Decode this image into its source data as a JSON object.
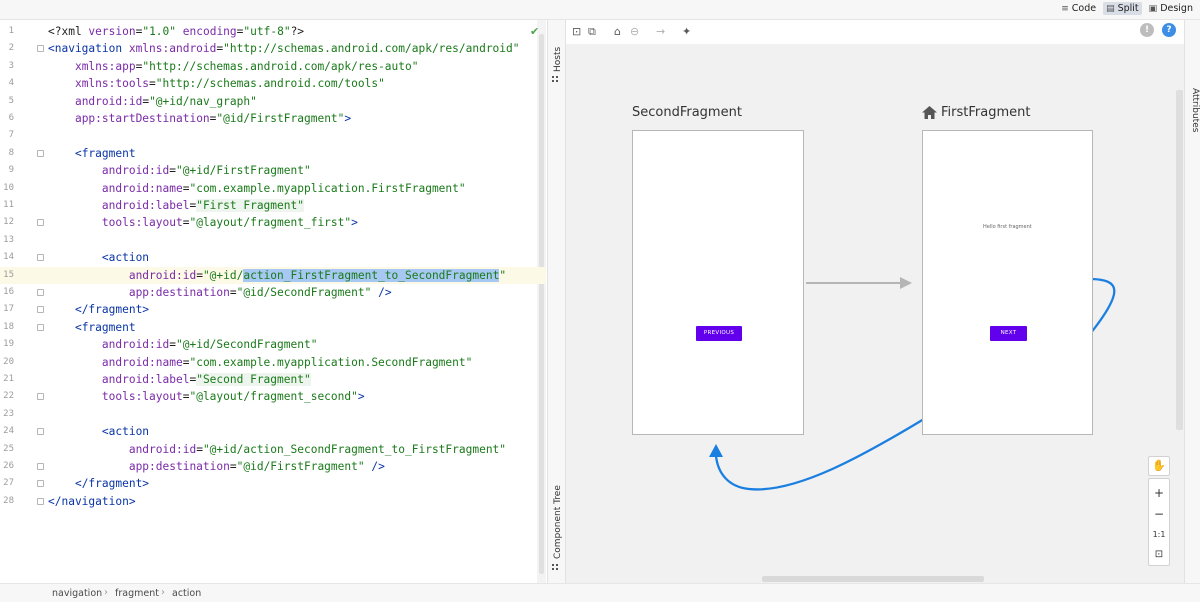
{
  "modes": {
    "code": "Code",
    "split": "Split",
    "design": "Design",
    "active": "split"
  },
  "editor": {
    "lines": [
      {
        "n": "1",
        "parts": [
          [
            "pun",
            "<?xml "
          ],
          [
            "attr",
            "version"
          ],
          [
            "pun",
            "="
          ],
          [
            "val",
            "\"1.0\""
          ],
          [
            "pun",
            " "
          ],
          [
            "attr",
            "encoding"
          ],
          [
            "pun",
            "="
          ],
          [
            "val",
            "\"utf-8\""
          ],
          [
            "pun",
            "?>"
          ]
        ]
      },
      {
        "n": "2",
        "parts": [
          [
            "tag",
            "<navigation "
          ],
          [
            "attr",
            "xmlns:android"
          ],
          [
            "pun",
            "="
          ],
          [
            "val",
            "\"http://schemas.android.com/apk/res/android\""
          ]
        ]
      },
      {
        "n": "3",
        "parts": [
          [
            "pun",
            "    "
          ],
          [
            "attr",
            "xmlns:app"
          ],
          [
            "pun",
            "="
          ],
          [
            "val",
            "\"http://schemas.android.com/apk/res-auto\""
          ]
        ]
      },
      {
        "n": "4",
        "parts": [
          [
            "pun",
            "    "
          ],
          [
            "attr",
            "xmlns:tools"
          ],
          [
            "pun",
            "="
          ],
          [
            "val",
            "\"http://schemas.android.com/tools\""
          ]
        ]
      },
      {
        "n": "5",
        "parts": [
          [
            "pun",
            "    "
          ],
          [
            "attr",
            "android:id"
          ],
          [
            "pun",
            "="
          ],
          [
            "val",
            "\"@+id/nav_graph\""
          ]
        ]
      },
      {
        "n": "6",
        "parts": [
          [
            "pun",
            "    "
          ],
          [
            "attr",
            "app:startDestination"
          ],
          [
            "pun",
            "="
          ],
          [
            "val",
            "\"@id/FirstFragment\""
          ],
          [
            "tag",
            ">"
          ]
        ]
      },
      {
        "n": "7",
        "parts": []
      },
      {
        "n": "8",
        "parts": [
          [
            "pun",
            "    "
          ],
          [
            "tag",
            "<fragment"
          ]
        ]
      },
      {
        "n": "9",
        "parts": [
          [
            "pun",
            "        "
          ],
          [
            "attr",
            "android:id"
          ],
          [
            "pun",
            "="
          ],
          [
            "val",
            "\"@+id/FirstFragment\""
          ]
        ]
      },
      {
        "n": "10",
        "parts": [
          [
            "pun",
            "        "
          ],
          [
            "attr",
            "android:name"
          ],
          [
            "pun",
            "="
          ],
          [
            "val",
            "\"com.example.myapplication.FirstFragment\""
          ]
        ]
      },
      {
        "n": "11",
        "parts": [
          [
            "pun",
            "        "
          ],
          [
            "attr",
            "android:label"
          ],
          [
            "pun",
            "="
          ],
          [
            "valhl",
            "\"First Fragment\""
          ]
        ]
      },
      {
        "n": "12",
        "parts": [
          [
            "pun",
            "        "
          ],
          [
            "attr",
            "tools:layout"
          ],
          [
            "pun",
            "="
          ],
          [
            "val",
            "\"@layout/fragment_first\""
          ],
          [
            "tag",
            ">"
          ]
        ]
      },
      {
        "n": "13",
        "parts": []
      },
      {
        "n": "14",
        "parts": [
          [
            "pun",
            "        "
          ],
          [
            "tag",
            "<action"
          ]
        ]
      },
      {
        "n": "15",
        "parts": [
          [
            "pun",
            "            "
          ],
          [
            "attr",
            "android:id"
          ],
          [
            "pun",
            "="
          ],
          [
            "val",
            "\"@+id/"
          ],
          [
            "sel",
            "action_FirstFragment_to_SecondFragment"
          ],
          [
            "val",
            "\""
          ]
        ]
      },
      {
        "n": "16",
        "parts": [
          [
            "pun",
            "            "
          ],
          [
            "attr",
            "app:destination"
          ],
          [
            "pun",
            "="
          ],
          [
            "val",
            "\"@id/SecondFragment\""
          ],
          [
            "tag",
            " />"
          ]
        ]
      },
      {
        "n": "17",
        "parts": [
          [
            "pun",
            "    "
          ],
          [
            "tag",
            "</fragment>"
          ]
        ]
      },
      {
        "n": "18",
        "parts": [
          [
            "pun",
            "    "
          ],
          [
            "tag",
            "<fragment"
          ]
        ]
      },
      {
        "n": "19",
        "parts": [
          [
            "pun",
            "        "
          ],
          [
            "attr",
            "android:id"
          ],
          [
            "pun",
            "="
          ],
          [
            "val",
            "\"@+id/SecondFragment\""
          ]
        ]
      },
      {
        "n": "20",
        "parts": [
          [
            "pun",
            "        "
          ],
          [
            "attr",
            "android:name"
          ],
          [
            "pun",
            "="
          ],
          [
            "val",
            "\"com.example.myapplication.SecondFragment\""
          ]
        ]
      },
      {
        "n": "21",
        "parts": [
          [
            "pun",
            "        "
          ],
          [
            "attr",
            "android:label"
          ],
          [
            "pun",
            "="
          ],
          [
            "valhl",
            "\"Second Fragment\""
          ]
        ]
      },
      {
        "n": "22",
        "parts": [
          [
            "pun",
            "        "
          ],
          [
            "attr",
            "tools:layout"
          ],
          [
            "pun",
            "="
          ],
          [
            "val",
            "\"@layout/fragment_second\""
          ],
          [
            "tag",
            ">"
          ]
        ]
      },
      {
        "n": "23",
        "parts": []
      },
      {
        "n": "24",
        "parts": [
          [
            "pun",
            "        "
          ],
          [
            "tag",
            "<action"
          ]
        ]
      },
      {
        "n": "25",
        "parts": [
          [
            "pun",
            "            "
          ],
          [
            "attr",
            "android:id"
          ],
          [
            "pun",
            "="
          ],
          [
            "val",
            "\"@+id/action_SecondFragment_to_FirstFragment\""
          ]
        ]
      },
      {
        "n": "26",
        "parts": [
          [
            "pun",
            "            "
          ],
          [
            "attr",
            "app:destination"
          ],
          [
            "pun",
            "="
          ],
          [
            "val",
            "\"@id/FirstFragment\""
          ],
          [
            "tag",
            " />"
          ]
        ]
      },
      {
        "n": "27",
        "parts": [
          [
            "pun",
            "    "
          ],
          [
            "tag",
            "</fragment>"
          ]
        ]
      },
      {
        "n": "28",
        "parts": [
          [
            "tag",
            "</navigation>"
          ]
        ]
      }
    ],
    "highlighted_line": "15",
    "fold_lines": [
      "2",
      "8",
      "12",
      "14",
      "16",
      "17",
      "18",
      "22",
      "24",
      "26",
      "27",
      "28"
    ]
  },
  "side_panels": {
    "hosts": "Hosts",
    "component_tree": "Component Tree",
    "attributes": "Attributes"
  },
  "breadcrumb": [
    "navigation",
    "fragment",
    "action"
  ],
  "toolbar_icons": [
    "new-destination-icon",
    "clone-icon",
    "home-icon",
    "link-icon",
    "arrow-icon",
    "auto-arrange-icon"
  ],
  "graph": {
    "second_fragment": {
      "title": "SecondFragment",
      "button": "PREVIOUS"
    },
    "first_fragment": {
      "title": "FirstFragment",
      "button": "NEXT",
      "text": "Hello first fragment",
      "is_start": true
    },
    "action_color": "#1a7fe0",
    "button_color": "#6200ee"
  },
  "zoom": {
    "zoom_in": "+",
    "zoom_out": "−",
    "fit": "1:1"
  },
  "status": {
    "error_count_icon": "error-icon",
    "help_icon": "help-icon"
  }
}
